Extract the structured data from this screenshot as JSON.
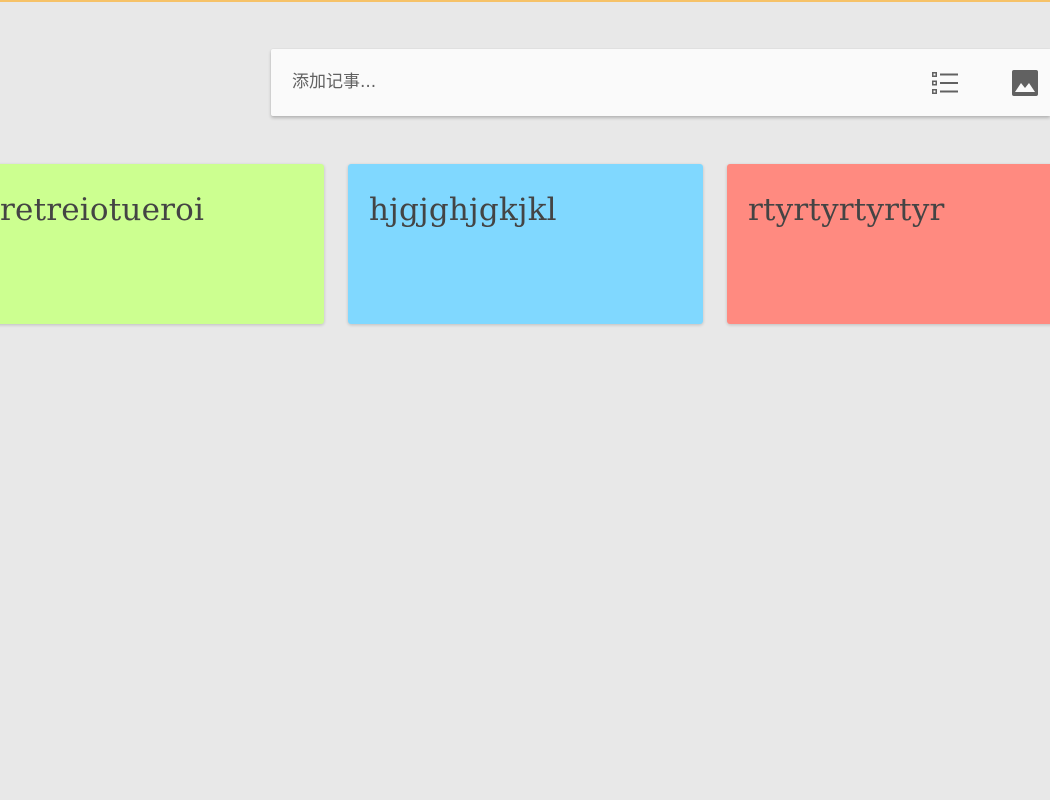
{
  "colors": {
    "background": "#e8e8e8",
    "top_strip": "#f6c268",
    "add_bar": "#fafafa",
    "icon": "#616161"
  },
  "add_note": {
    "placeholder": "添加记事...",
    "value": "",
    "list_icon": "checklist-icon",
    "image_icon": "image-icon"
  },
  "notes": [
    {
      "text": "retreiotueroi",
      "color": "#ccff90"
    },
    {
      "text": "hjgjghjgkjkl",
      "color": "#80d8ff"
    },
    {
      "text": "rtyrtyrtyrtyr",
      "color": "#ff8a80"
    }
  ]
}
